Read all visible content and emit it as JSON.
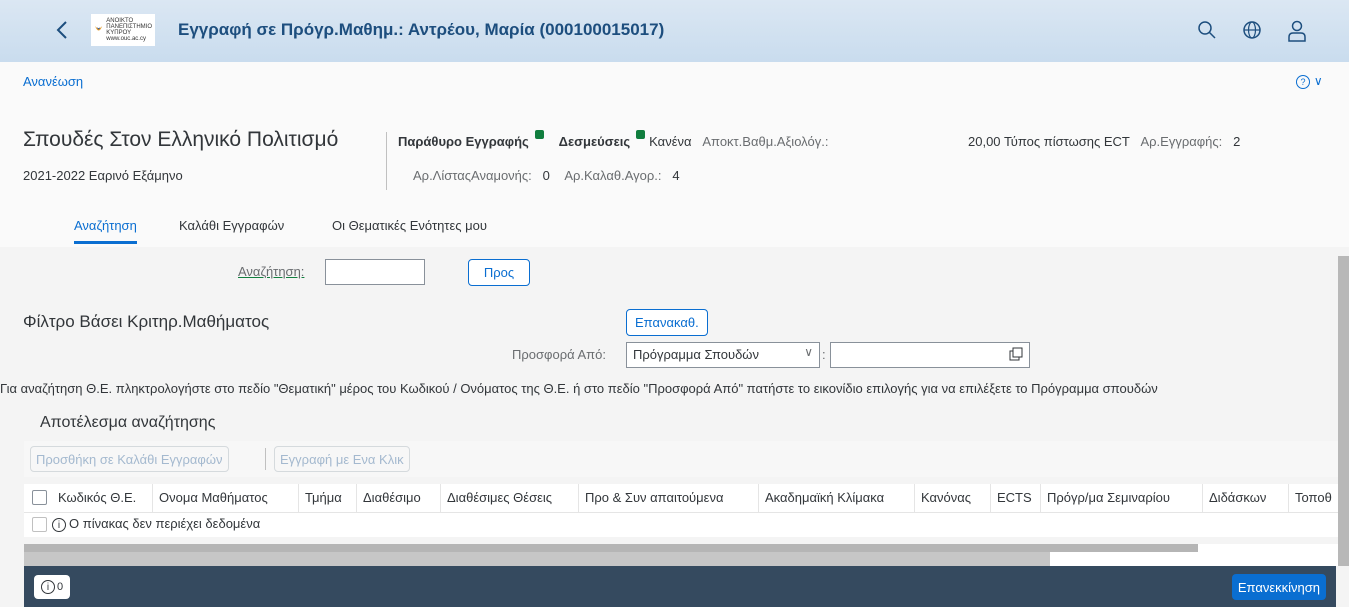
{
  "shell": {
    "title": "Εγγραφή σε Πρόγρ.Μαθημ.: Αντρέου, Μαρία (000100015017)",
    "logo_text": [
      "ΑΝΟΙΚΤΟ",
      "ΠΑΝΕΠΙΣΤΗΜΙΟ",
      "ΚΥΠΡΟΥ",
      "www.ouc.ac.cy"
    ],
    "icons": [
      "back-icon",
      "search-icon",
      "globe-icon",
      "user-icon"
    ]
  },
  "header": {
    "refresh": "Ανανέωση",
    "help": "?",
    "title": "Σπουδές Στον Ελληνικό Πολιτισμό",
    "subtitle": "2021-2022 Εαρινό Εξάμηνο",
    "kpi": {
      "window_label": "Παράθυρο Εγγραφής",
      "commitments_label": "Δεσμεύσεις",
      "rule_value": "Κανένα",
      "grade_label": "Αποκτ.Βαθμ.Αξιολόγ.:",
      "grade_value": "20,00",
      "credit_type": "Τύπος πίστωσης ECT",
      "reg_label": "Αρ.Εγγραφής:",
      "reg_value": "2",
      "waitlist_label": "Αρ.ΛίσταςΑναμονής:",
      "waitlist_value": "0",
      "cart_label": "Αρ.Καλαθ.Αγορ.:",
      "cart_value": "4"
    },
    "status_color": "#107e3e"
  },
  "tabs": [
    "Αναζήτηση",
    "Καλάθι Εγγραφών",
    "Οι Θεματικές Ενότητες μου"
  ],
  "search": {
    "label": "Αναζήτηση:",
    "value": "",
    "go_button": "Προς"
  },
  "filter": {
    "title": "Φίλτρο Βάσει Κριτηρ.Μαθήματος",
    "reset_button": "Επανακαθ.",
    "offer_label": "Προσφορά Από:",
    "offer_selected": "Πρόγραμμα Σπουδών",
    "offer_colon": ":",
    "offer_value": "",
    "hint": "Για αναζήτηση Θ.Ε. πληκτρολογήστε στο πεδίο \"Θεματική\" μέρος του Κωδικού / Ονόματος της Θ.Ε. ή στο πεδίο \"Προσφορά Από\" πατήστε το εικονίδιο επιλογής για να επιλέξετε το Πρόγραμμα σπουδών"
  },
  "results": {
    "title": "Αποτέλεσμα αναζήτησης",
    "add_to_cart": "Προσθήκη σε Καλάθι Εγγραφών",
    "one_click": "Εγγραφή με Ενα Κλικ",
    "columns": [
      "Κωδικός Θ.Ε.",
      "Ονομα Μαθήματος",
      "Τμήμα",
      "Διαθέσιμο",
      "Διαθέσιμες Θέσεις",
      "Προ & Συν απαιτούμενα",
      "Ακαδημαϊκή Κλίμακα",
      "Κανόνας",
      "ECTS",
      "Πρόγρ/μα Σεμιναρίου",
      "Διδάσκων",
      "Τοποθ"
    ],
    "empty": "Ο πίνακας δεν περιέχει δεδομένα"
  },
  "footer": {
    "message_count": "0",
    "restart": "Επανεκκίνηση"
  }
}
